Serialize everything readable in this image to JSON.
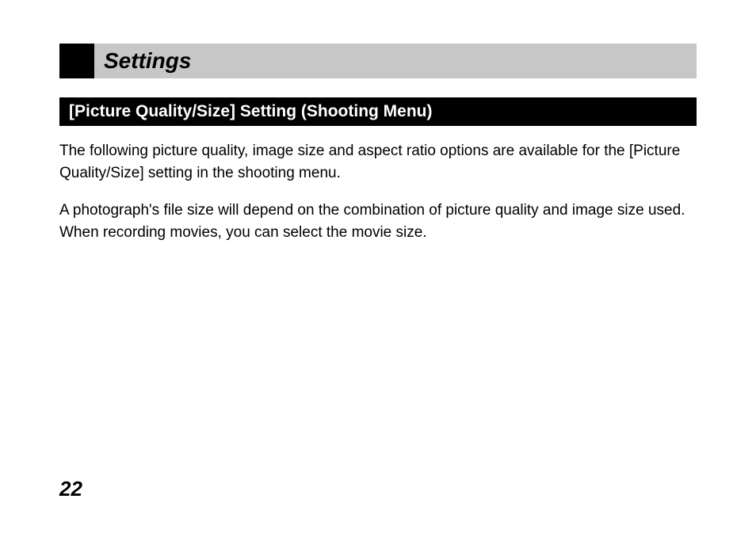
{
  "section_title": "Settings",
  "sub_heading": "[Picture Quality/Size] Setting (Shooting Menu)",
  "paragraphs": [
    "The following picture quality, image size and aspect ratio options are available for the [Picture Quality/Size] setting in the shooting menu.",
    "A photograph's file size will depend on the combination of picture quality and image size used. When recording movies, you can select the movie size."
  ],
  "page_number": "22"
}
